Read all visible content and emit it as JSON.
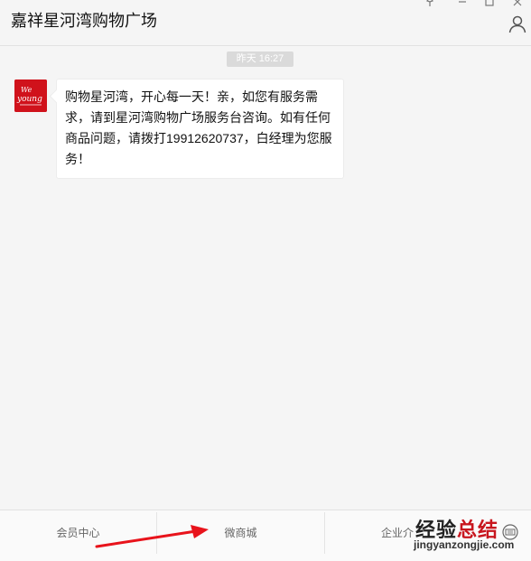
{
  "window": {
    "title": "嘉祥星河湾购物广场",
    "controls": [
      "pin-icon",
      "minimize-icon",
      "maximize-icon",
      "close-icon"
    ],
    "profile_icon": "person-icon"
  },
  "chat": {
    "timestamp": "昨天  16:27",
    "avatar_text": "We young",
    "message": "购物星河湾，开心每一天！亲，如您有服务需求，请到星河湾购物广场服务台咨询。如有任何商品问题，请拨打19912620737，白经理为您服务！"
  },
  "menu": {
    "items": [
      "会员中心",
      "微商城",
      "企业介"
    ],
    "keyboard_icon": "keyboard-icon"
  },
  "watermark": {
    "title_a": "经验",
    "title_b": "总结",
    "url": "jingyanzongjie.com"
  },
  "colors": {
    "brand_red": "#d0121b",
    "arrow_red": "#e8131b",
    "background": "#f5f5f5"
  }
}
